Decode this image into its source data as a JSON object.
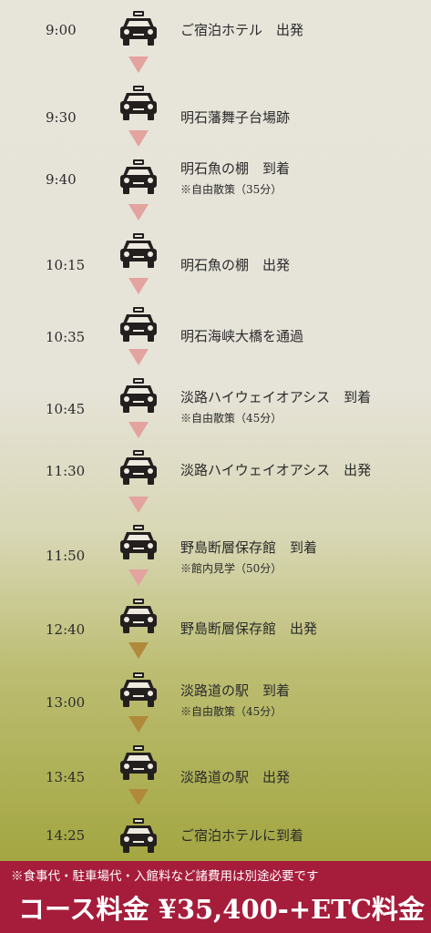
{
  "colors": {
    "arrow_pink": "#e3a39e",
    "arrow_olive": "#b08a3a",
    "footer_bg": "#a51d3b"
  },
  "icon": "taxi-icon",
  "schedule": [
    {
      "time": "9:00",
      "name": "ご宿泊ホテル　出発",
      "note": ""
    },
    {
      "time": "9:30",
      "name": "明石藩舞子台場跡",
      "note": ""
    },
    {
      "time": "9:40",
      "name": "明石魚の棚　到着",
      "note": "※自由散策（35分）"
    },
    {
      "time": "10:15",
      "name": "明石魚の棚　出発",
      "note": ""
    },
    {
      "time": "10:35",
      "name": "明石海峡大橋を通過",
      "note": ""
    },
    {
      "time": "10:45",
      "name": "淡路ハイウェイオアシス　到着",
      "note": "※自由散策（45分）"
    },
    {
      "time": "11:30",
      "name": "淡路ハイウェイオアシス　出発",
      "note": ""
    },
    {
      "time": "11:50",
      "name": "野島断層保存館　到着",
      "note": "※館内見学（50分）"
    },
    {
      "time": "12:40",
      "name": "野島断層保存館　出発",
      "note": ""
    },
    {
      "time": "13:00",
      "name": "淡路道の駅　到着",
      "note": "※自由散策（45分）"
    },
    {
      "time": "13:45",
      "name": "淡路道の駅　出発",
      "note": ""
    },
    {
      "time": "14:25",
      "name": "ご宿泊ホテルに到着",
      "note": ""
    }
  ],
  "footer": {
    "note": "※食事代・駐車場代・入館料など諸費用は別途必要です",
    "price": "コース料金 ¥35,400-+ETC料金"
  }
}
